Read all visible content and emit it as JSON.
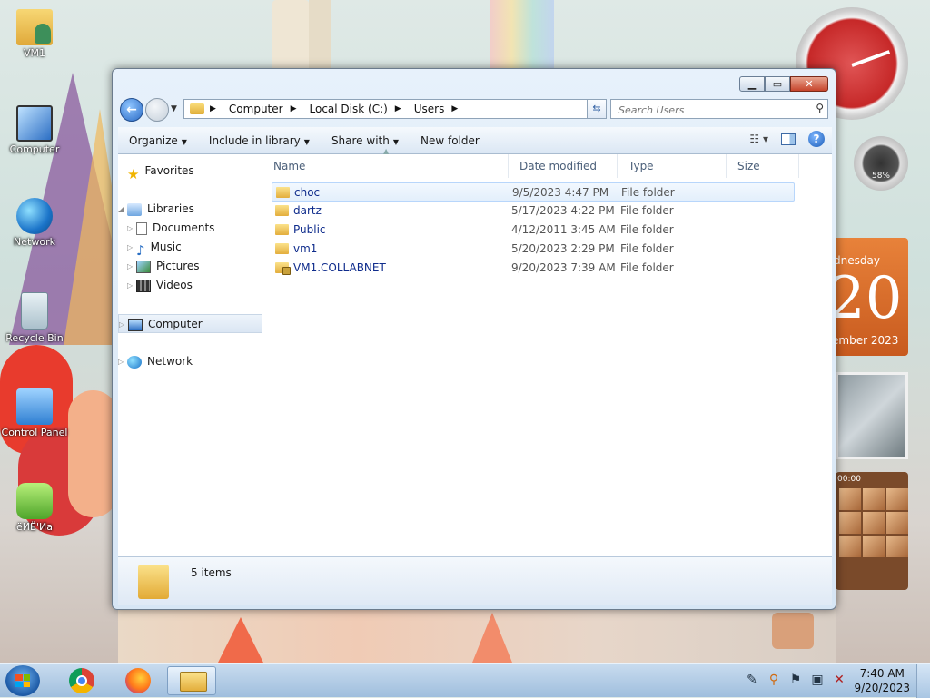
{
  "desktop": {
    "icons": [
      {
        "label": "VM1"
      },
      {
        "label": "Computer"
      },
      {
        "label": "Network"
      },
      {
        "label": "Recycle Bin"
      },
      {
        "label": "Control Panel"
      },
      {
        "label": "ёИЁ'Иа"
      }
    ]
  },
  "gadgets": {
    "meter_percent": "58%",
    "calendar": {
      "day": "dnesday",
      "date": "20",
      "month": "ember 2023"
    },
    "puzzle_time": "00:00"
  },
  "window": {
    "address": {
      "crumbs": [
        "Computer",
        "Local Disk (C:)",
        "Users"
      ]
    },
    "search": {
      "placeholder": "Search Users"
    },
    "toolbar": {
      "organize": "Organize",
      "include_in_library": "Include in library",
      "share_with": "Share with",
      "new_folder": "New folder"
    },
    "nav": {
      "favorites": "Favorites",
      "libraries": "Libraries",
      "documents": "Documents",
      "music": "Music",
      "pictures": "Pictures",
      "videos": "Videos",
      "computer": "Computer",
      "network": "Network"
    },
    "columns": {
      "name": "Name",
      "date": "Date modified",
      "type": "Type",
      "size": "Size"
    },
    "files": [
      {
        "name": "choc",
        "date": "9/5/2023 4:47 PM",
        "type": "File folder"
      },
      {
        "name": "dartz",
        "date": "5/17/2023 4:22 PM",
        "type": "File folder"
      },
      {
        "name": "Public",
        "date": "4/12/2011 3:45 AM",
        "type": "File folder"
      },
      {
        "name": "vm1",
        "date": "5/20/2023 2:29 PM",
        "type": "File folder"
      },
      {
        "name": "VM1.COLLABNET",
        "date": "9/20/2023 7:39 AM",
        "type": "File folder"
      }
    ],
    "status": {
      "item_count": "5 items"
    }
  },
  "taskbar": {
    "time": "7:40 AM",
    "date": "9/20/2023"
  },
  "colors": {
    "link_text": "#0f2c8c",
    "hover_row": "#e3effc",
    "folder": "#e3ae3c"
  }
}
